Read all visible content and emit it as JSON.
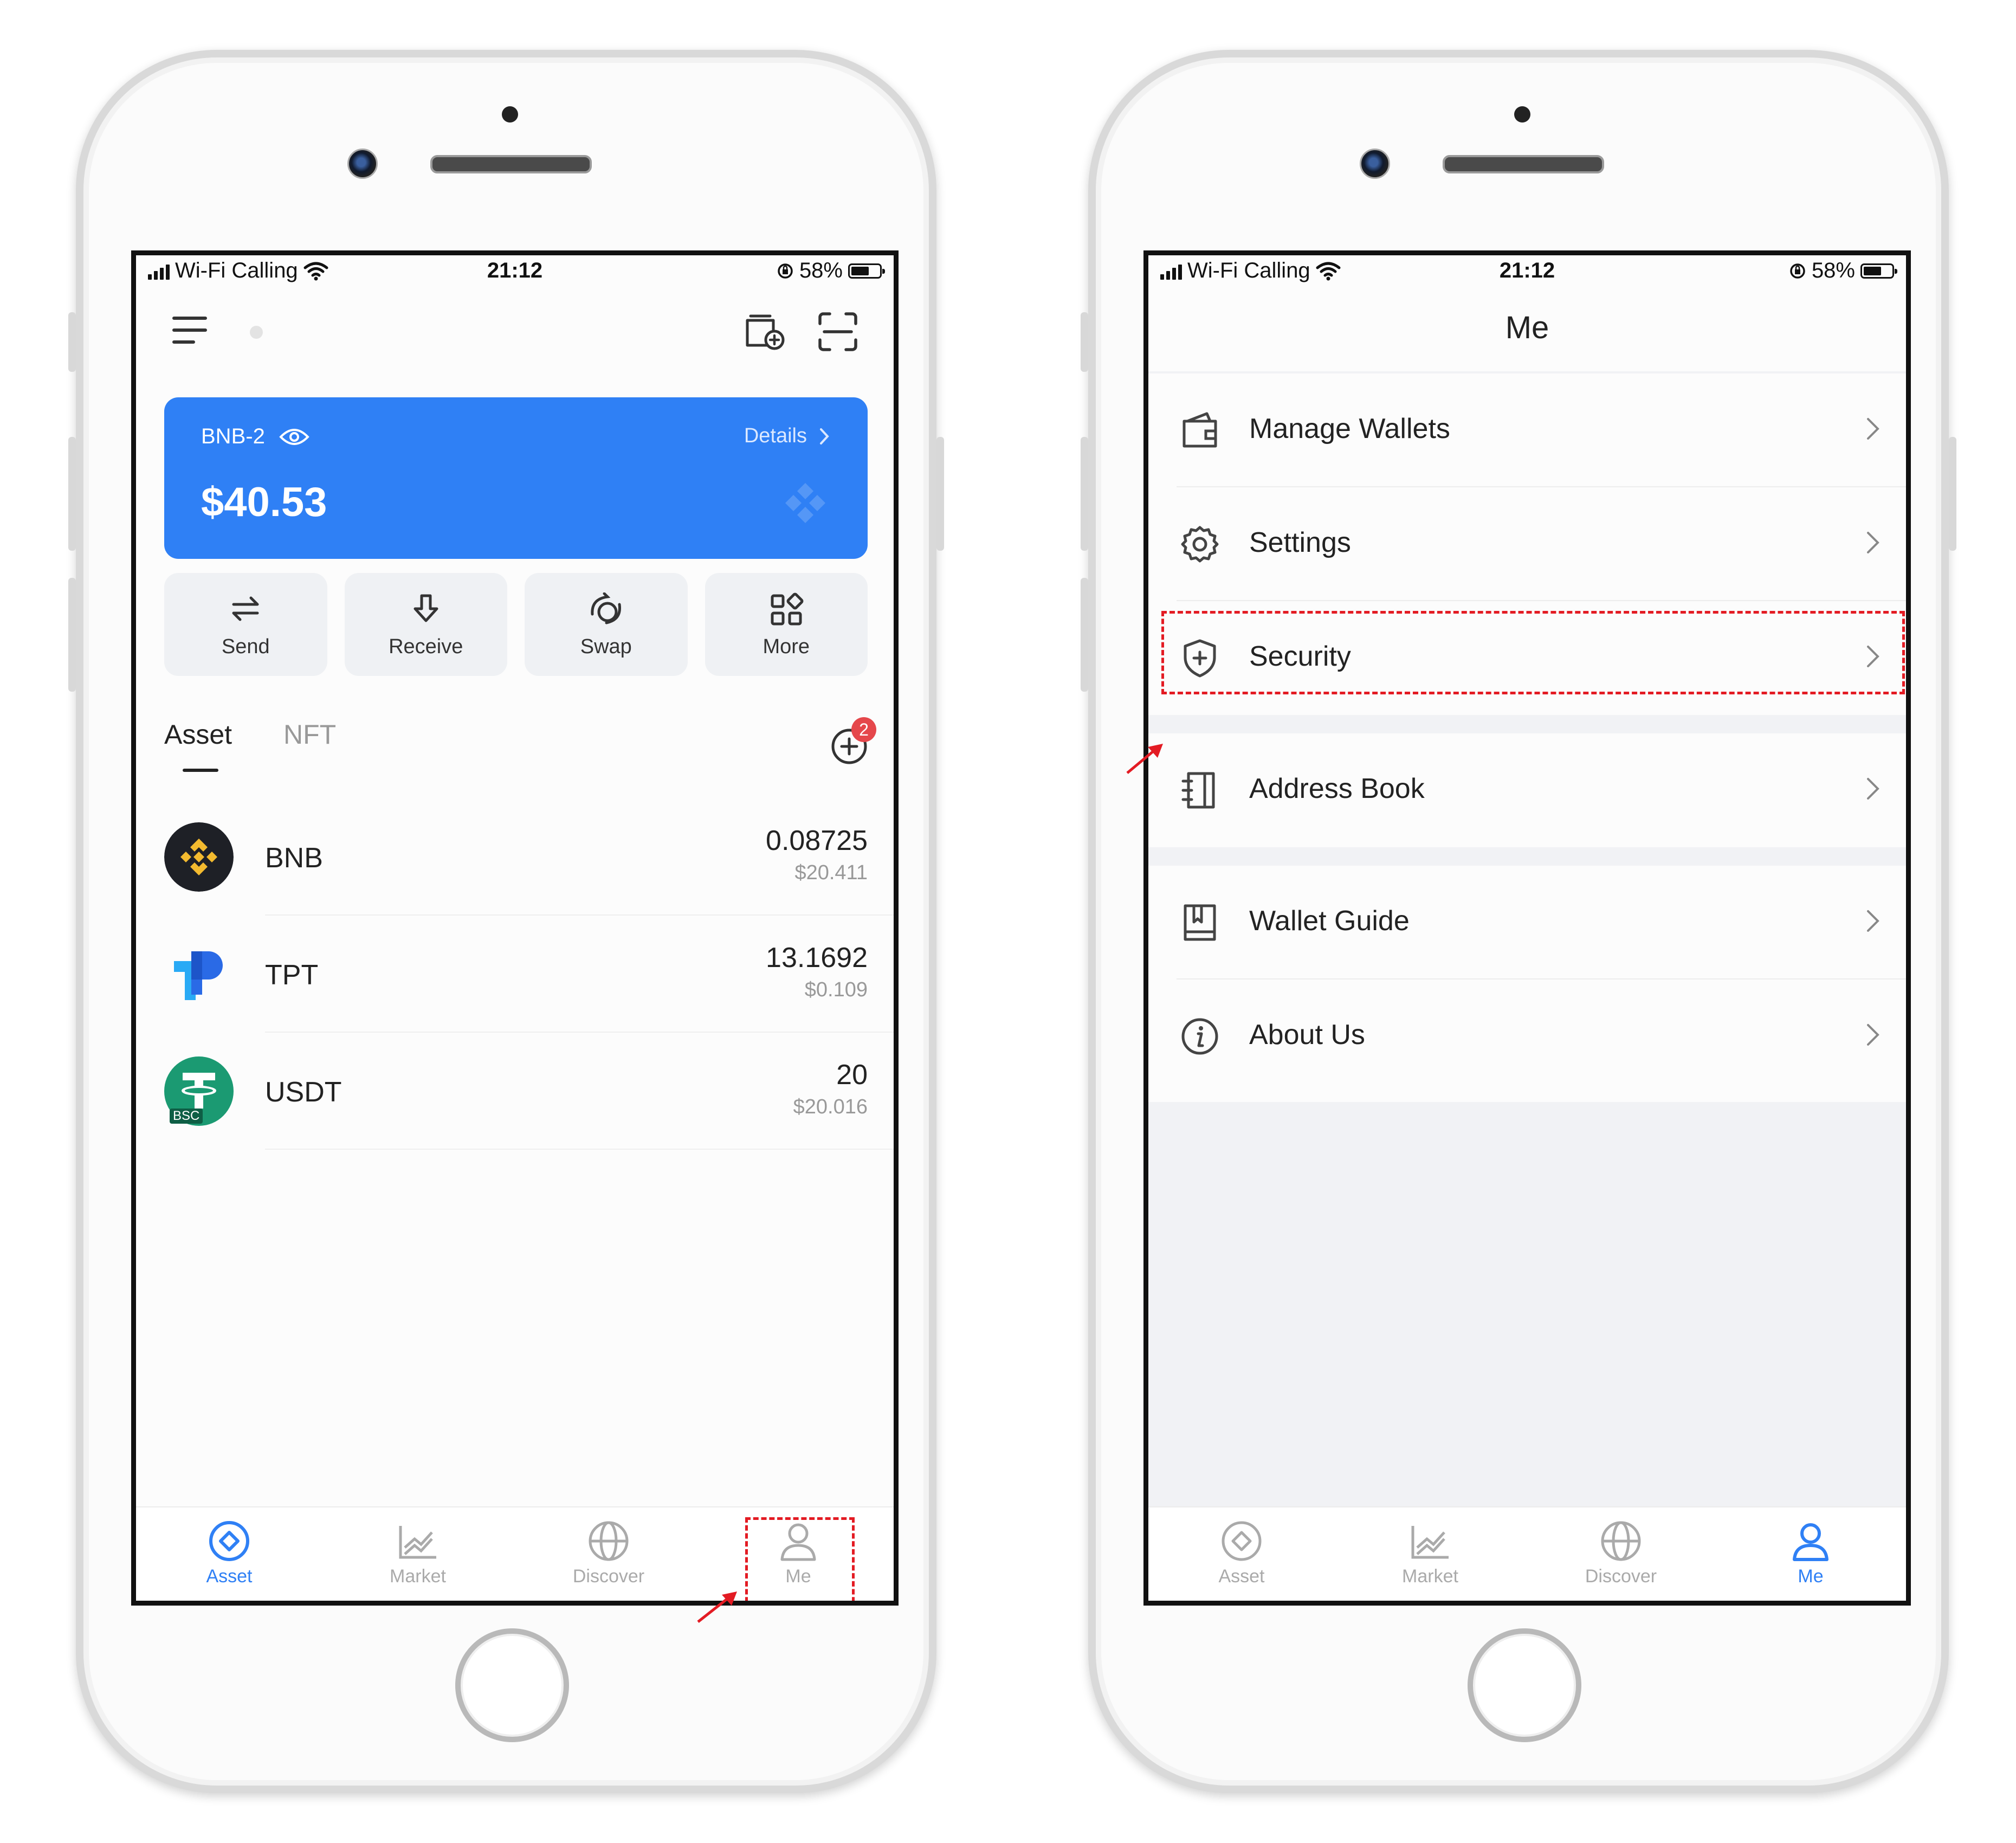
{
  "status_bar": {
    "carrier": "Wi-Fi Calling",
    "time": "21:12",
    "battery": "58%"
  },
  "left_screen": {
    "wallet": {
      "name": "BNB-2",
      "details_label": "Details",
      "balance": "$40.53"
    },
    "actions": [
      {
        "label": "Send",
        "icon": "send-icon"
      },
      {
        "label": "Receive",
        "icon": "receive-icon"
      },
      {
        "label": "Swap",
        "icon": "swap-icon"
      },
      {
        "label": "More",
        "icon": "more-icon"
      }
    ],
    "tabs": {
      "active": "Asset",
      "inactive": "NFT"
    },
    "add_badge": "2",
    "assets": [
      {
        "symbol": "BNB",
        "amount": "0.08725",
        "usd": "$20.411",
        "icon": "bnb-logo"
      },
      {
        "symbol": "TPT",
        "amount": "13.1692",
        "usd": "$0.109",
        "icon": "tpt-logo"
      },
      {
        "symbol": "USDT",
        "amount": "20",
        "usd": "$20.016",
        "icon": "usdt-bsc-logo",
        "chain_tag": "BSC"
      }
    ]
  },
  "right_screen": {
    "title": "Me",
    "menu": [
      {
        "label": "Manage Wallets",
        "icon": "wallet-icon"
      },
      {
        "label": "Settings",
        "icon": "gear-icon"
      },
      {
        "label": "Security",
        "icon": "shield-icon"
      },
      {
        "label": "Address Book",
        "icon": "address-book-icon"
      },
      {
        "label": "Wallet Guide",
        "icon": "guide-book-icon"
      },
      {
        "label": "About Us",
        "icon": "info-icon"
      }
    ]
  },
  "tabbar": {
    "items": [
      {
        "label": "Asset",
        "icon": "asset-icon"
      },
      {
        "label": "Market",
        "icon": "market-icon"
      },
      {
        "label": "Discover",
        "icon": "globe-icon"
      },
      {
        "label": "Me",
        "icon": "person-icon"
      }
    ],
    "accent": "#2f80f5",
    "inactive_color": "#aaaaaa"
  },
  "colors": {
    "card_blue": "#2f80f5",
    "highlight_red": "#e31b23",
    "badge_red": "#e5474b"
  }
}
